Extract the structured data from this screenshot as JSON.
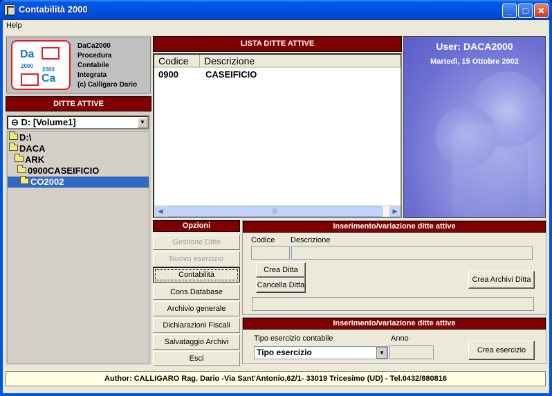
{
  "window": {
    "title": "Contabilità 2000"
  },
  "menu": {
    "help_label": "Help"
  },
  "logo": {
    "da": "Da",
    "ca": "Ca",
    "year1": "2000",
    "year2": "2000",
    "lines": [
      "DaCa2000",
      "Procedura",
      "Contabile",
      "Integrata",
      "(c) Calligaro Dario"
    ]
  },
  "ditte": {
    "header": "DITTE ATTIVE",
    "drive": "D: [Volume1]",
    "tree": [
      "D:\\",
      "DACA",
      "ARK",
      "0900CASEIFICIO",
      "CO2002"
    ]
  },
  "lista": {
    "header": "LISTA DITTE ATTIVE",
    "columns": [
      "Codice",
      "Descrizione"
    ],
    "rows": [
      {
        "codice": "0900",
        "descrizione": "CASEIFICIO"
      }
    ]
  },
  "user": {
    "title": "User: DACA2000",
    "date": "Martedì, 15 Ottobre 2002"
  },
  "opzioni": {
    "header": "Opzioni",
    "buttons": [
      "Gestione Ditte",
      "Nuovo esercizio",
      "Contabilità",
      "Cons.Database",
      "Archivio generale",
      "Dichiarazioni Fiscali",
      "Salvataggio Archivi",
      "Esci"
    ]
  },
  "ins1": {
    "header": "Inserimento/variazione ditte attive",
    "codice_label": "Codice",
    "descrizione_label": "Descrizione",
    "codice_value": "",
    "descrizione_value": "",
    "note_value": "",
    "crea_ditta": "Crea Ditta",
    "cancella_ditta": "Cancella Ditta",
    "crea_archivi": "Crea Archivi Ditta"
  },
  "ins2": {
    "header": "Inserimento/variazione ditte attive",
    "tipo_label": "Tipo esercizio contabile",
    "anno_label": "Anno",
    "tipo_value": "Tipo esercizio",
    "anno_value": "",
    "crea_esercizio": "Crea esercizio"
  },
  "status": {
    "text": "Author: CALLIGARO Rag. Dario -Via Sant'Antonio,62/1- 33019 Tricesimo (UD) - Tel.0432/880816"
  }
}
